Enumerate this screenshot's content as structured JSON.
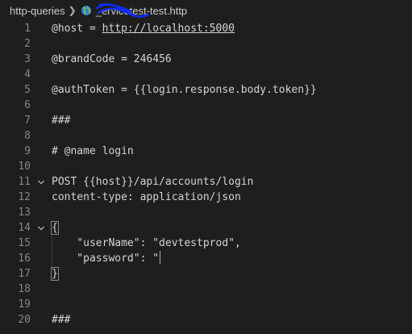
{
  "breadcrumb": {
    "folder": "http-queries",
    "file": "_ervicetest-test.http"
  },
  "lines": [
    {
      "n": "1",
      "text": "@host = ",
      "link": "http://localhost:5000"
    },
    {
      "n": "2",
      "text": ""
    },
    {
      "n": "3",
      "text": "@brandCode = 246456"
    },
    {
      "n": "4",
      "text": ""
    },
    {
      "n": "5",
      "text": "@authToken = {{login.response.body.token}}"
    },
    {
      "n": "6",
      "text": ""
    },
    {
      "n": "7",
      "text": "###"
    },
    {
      "n": "8",
      "text": ""
    },
    {
      "n": "9",
      "text": "# @name login"
    },
    {
      "n": "10",
      "text": ""
    },
    {
      "n": "11",
      "text": "POST {{host}}/api/accounts/login",
      "fold": true
    },
    {
      "n": "12",
      "text": "content-type: application/json"
    },
    {
      "n": "13",
      "text": ""
    },
    {
      "n": "14",
      "text": "{",
      "fold": true
    },
    {
      "n": "15",
      "text": "    \"userName\": \"devtestprod\","
    },
    {
      "n": "16",
      "text": "    \"password\": \""
    },
    {
      "n": "17",
      "text": "}"
    },
    {
      "n": "18",
      "text": ""
    },
    {
      "n": "19",
      "text": ""
    },
    {
      "n": "20",
      "text": "###"
    }
  ]
}
